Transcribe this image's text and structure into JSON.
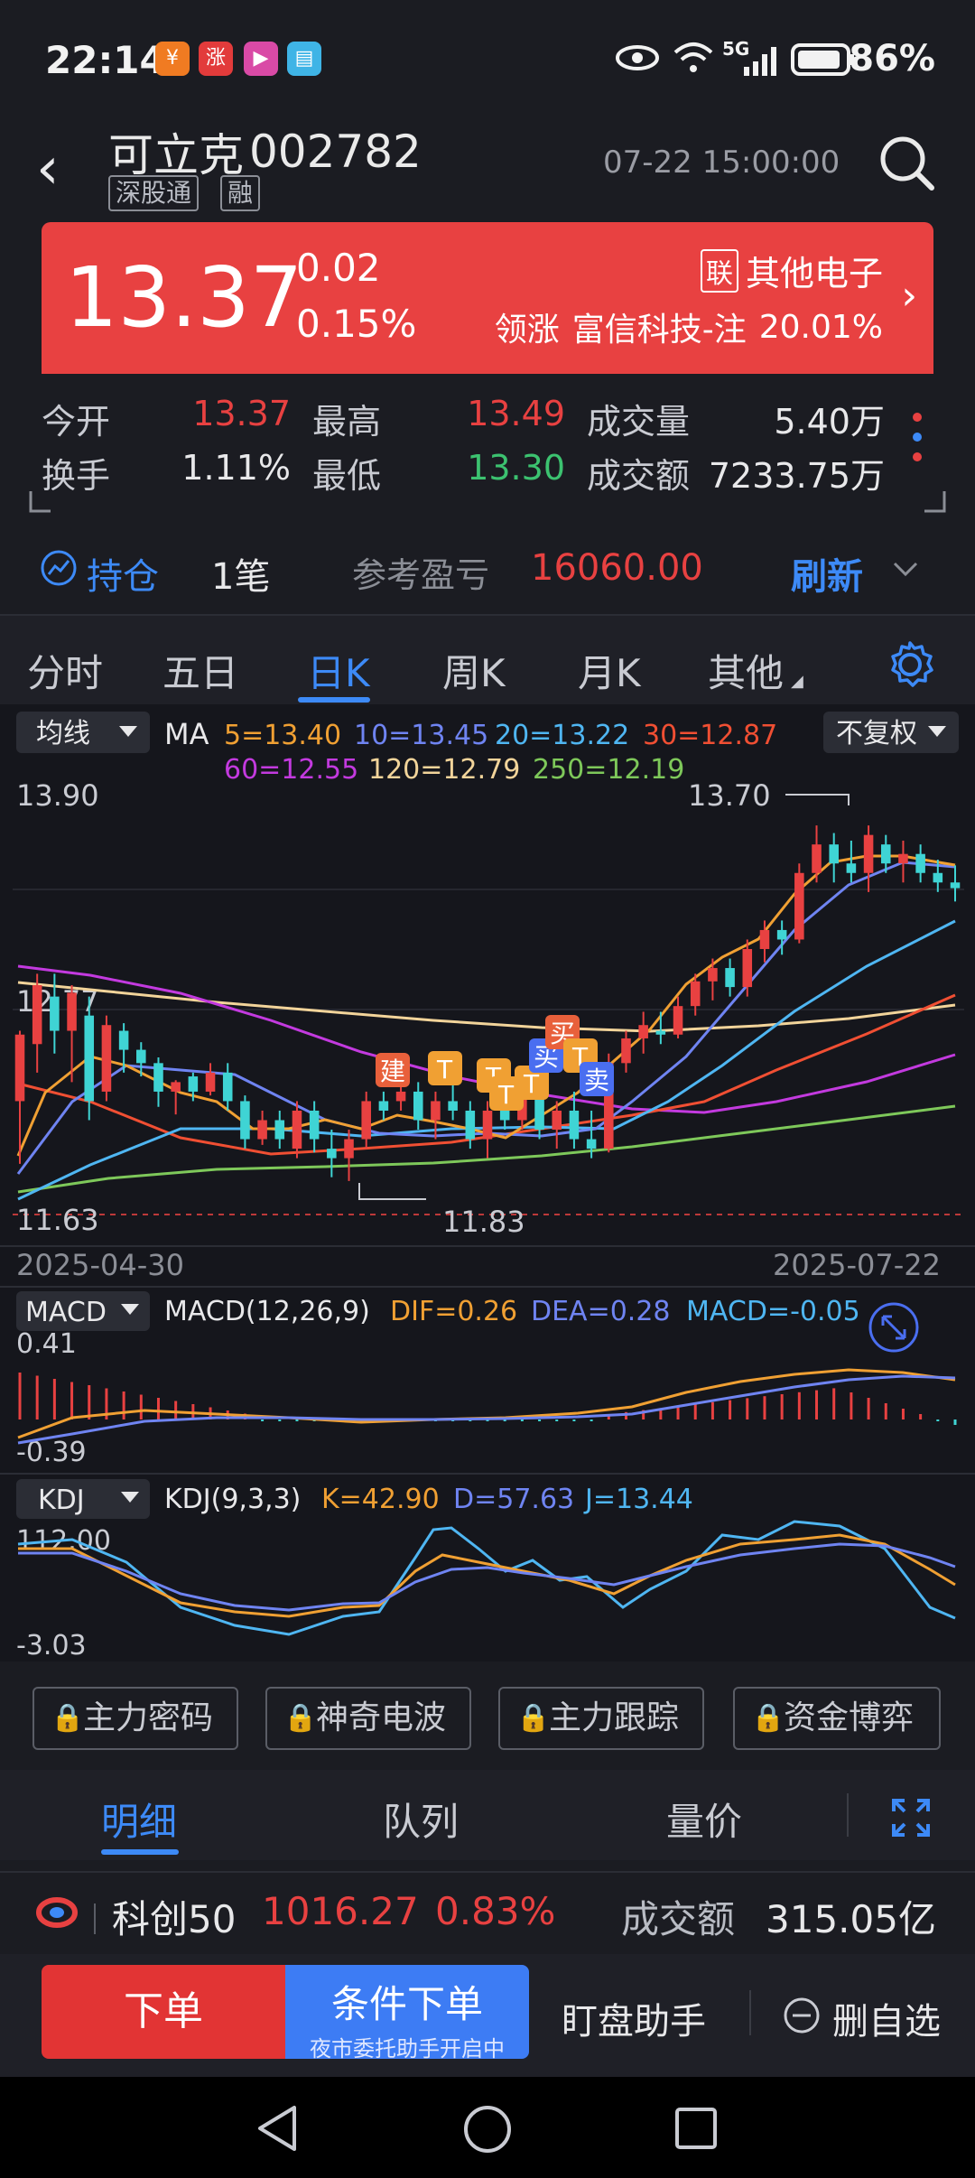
{
  "status": {
    "time": "22:14",
    "battery": "86%",
    "network": "5G",
    "notif_icons": [
      "red-envelope-icon",
      "zhang-app-icon",
      "video-app-icon",
      "book-app-icon"
    ],
    "notif_labels": [
      "¥",
      "涨",
      "▶",
      "📖"
    ]
  },
  "header": {
    "name": "可立克",
    "code": "002782",
    "tags": [
      "深股通",
      "融"
    ],
    "datetime": "07-22 15:00:00"
  },
  "price": {
    "last": "13.37",
    "change": "0.02",
    "change_pct": "0.15%",
    "sector_badge": "联",
    "sector": "其他电子",
    "lead_label": "领涨",
    "lead_stock": "富信科技-注",
    "lead_pct": "20.01%",
    "banner_color": "#e84141"
  },
  "quote": {
    "open_label": "今开",
    "open": "13.37",
    "high_label": "最高",
    "high": "13.49",
    "volume_label": "成交量",
    "volume": "5.40万",
    "turnover_label": "换手",
    "turnover": "1.11%",
    "low_label": "最低",
    "low": "13.30",
    "amount_label": "成交额",
    "amount": "7233.75万"
  },
  "position": {
    "label": "持仓",
    "count": "1笔",
    "pl_label": "参考盈亏",
    "pl_value": "16060.00",
    "refresh": "刷新"
  },
  "tabs": [
    "分时",
    "五日",
    "日K",
    "周K",
    "月K",
    "其他"
  ],
  "active_tab": "日K",
  "chart": {
    "ma_selector": "均线",
    "ma_label": "MA",
    "ma_values": [
      {
        "text": "5=13.40",
        "color": "#f0a033"
      },
      {
        "text": "10=13.45",
        "color": "#6f84f2"
      },
      {
        "text": "20=13.22",
        "color": "#4fb6f2"
      },
      {
        "text": "30=12.87",
        "color": "#f04f33"
      },
      {
        "text": "60=12.55",
        "color": "#c33adf"
      },
      {
        "text": "120=12.79",
        "color": "#f2d49a"
      },
      {
        "text": "250=12.19",
        "color": "#7ec85a"
      }
    ],
    "adjust": "不复权",
    "price_top": "13.90",
    "price_mid": "12.77",
    "price_bottom": "11.63",
    "high_mark": "13.70",
    "low_mark": "11.83",
    "date_start": "2025-04-30",
    "date_end": "2025-07-22",
    "trade_marks": [
      "建",
      "T",
      "T",
      "T",
      "T",
      "买",
      "卖",
      "T",
      "买",
      "卖"
    ],
    "macd_selector": "MACD",
    "macd_params": "MACD(12,26,9)",
    "macd_dif": "DIF=0.26",
    "macd_dea": "DEA=0.28",
    "macd_val": "MACD=-0.05",
    "macd_top": "0.41",
    "macd_bottom": "-0.39",
    "kdj_selector": "KDJ",
    "kdj_params": "KDJ(9,3,3)",
    "kdj_k": "K=42.90",
    "kdj_d": "D=57.63",
    "kdj_j": "J=13.44",
    "kdj_top": "112.00",
    "kdj_bottom": "-3.03"
  },
  "chart_data": {
    "type": "candlestick",
    "x_start": "2025-04-30",
    "x_end": "2025-07-22",
    "ylim": [
      11.63,
      13.9
    ],
    "up_color": "#e84141",
    "down_color": "#3fd4d4",
    "candles": [
      {
        "o": 12.25,
        "h": 12.62,
        "l": 11.92,
        "c": 12.6
      },
      {
        "o": 12.55,
        "h": 12.92,
        "l": 12.4,
        "c": 12.86
      },
      {
        "o": 12.8,
        "h": 12.92,
        "l": 12.5,
        "c": 12.62
      },
      {
        "o": 12.62,
        "h": 12.86,
        "l": 12.35,
        "c": 12.82
      },
      {
        "o": 12.7,
        "h": 12.8,
        "l": 12.15,
        "c": 12.25
      },
      {
        "o": 12.3,
        "h": 12.7,
        "l": 12.25,
        "c": 12.65
      },
      {
        "o": 12.62,
        "h": 12.66,
        "l": 12.4,
        "c": 12.52
      },
      {
        "o": 12.52,
        "h": 12.56,
        "l": 12.38,
        "c": 12.45
      },
      {
        "o": 12.45,
        "h": 12.48,
        "l": 12.22,
        "c": 12.3
      },
      {
        "o": 12.3,
        "h": 12.36,
        "l": 12.18,
        "c": 12.35
      },
      {
        "o": 12.38,
        "h": 12.4,
        "l": 12.25,
        "c": 12.3
      },
      {
        "o": 12.3,
        "h": 12.45,
        "l": 12.28,
        "c": 12.4
      },
      {
        "o": 12.4,
        "h": 12.45,
        "l": 12.2,
        "c": 12.25
      },
      {
        "o": 12.25,
        "h": 12.28,
        "l": 12.0,
        "c": 12.05
      },
      {
        "o": 12.05,
        "h": 12.2,
        "l": 12.02,
        "c": 12.15
      },
      {
        "o": 12.15,
        "h": 12.2,
        "l": 12.0,
        "c": 12.05
      },
      {
        "o": 12.0,
        "h": 12.25,
        "l": 11.95,
        "c": 12.2
      },
      {
        "o": 12.2,
        "h": 12.25,
        "l": 11.98,
        "c": 12.05
      },
      {
        "o": 12.0,
        "h": 12.1,
        "l": 11.85,
        "c": 11.95
      },
      {
        "o": 11.95,
        "h": 12.1,
        "l": 11.83,
        "c": 12.05
      },
      {
        "o": 12.05,
        "h": 12.3,
        "l": 12.0,
        "c": 12.25
      },
      {
        "o": 12.25,
        "h": 12.3,
        "l": 12.15,
        "c": 12.2
      },
      {
        "o": 12.25,
        "h": 12.35,
        "l": 12.2,
        "c": 12.3
      },
      {
        "o": 12.3,
        "h": 12.35,
        "l": 12.1,
        "c": 12.15
      },
      {
        "o": 12.15,
        "h": 12.3,
        "l": 12.05,
        "c": 12.25
      },
      {
        "o": 12.25,
        "h": 12.35,
        "l": 12.15,
        "c": 12.2
      },
      {
        "o": 12.2,
        "h": 12.25,
        "l": 12.0,
        "c": 12.05
      },
      {
        "o": 12.05,
        "h": 12.25,
        "l": 11.95,
        "c": 12.2
      },
      {
        "o": 12.2,
        "h": 12.3,
        "l": 12.1,
        "c": 12.15
      },
      {
        "o": 12.15,
        "h": 12.35,
        "l": 12.1,
        "c": 12.3
      },
      {
        "o": 12.3,
        "h": 12.4,
        "l": 12.05,
        "c": 12.1
      },
      {
        "o": 12.1,
        "h": 12.25,
        "l": 12.0,
        "c": 12.2
      },
      {
        "o": 12.2,
        "h": 12.3,
        "l": 12.0,
        "c": 12.05
      },
      {
        "o": 12.05,
        "h": 12.2,
        "l": 11.95,
        "c": 12.0
      },
      {
        "o": 12.0,
        "h": 12.5,
        "l": 11.98,
        "c": 12.45
      },
      {
        "o": 12.45,
        "h": 12.62,
        "l": 12.4,
        "c": 12.58
      },
      {
        "o": 12.58,
        "h": 12.72,
        "l": 12.5,
        "c": 12.65
      },
      {
        "o": 12.62,
        "h": 12.72,
        "l": 12.55,
        "c": 12.6
      },
      {
        "o": 12.6,
        "h": 12.8,
        "l": 12.58,
        "c": 12.75
      },
      {
        "o": 12.75,
        "h": 12.92,
        "l": 12.7,
        "c": 12.88
      },
      {
        "o": 12.88,
        "h": 13.0,
        "l": 12.78,
        "c": 12.95
      },
      {
        "o": 12.95,
        "h": 13.0,
        "l": 12.8,
        "c": 12.85
      },
      {
        "o": 12.85,
        "h": 13.1,
        "l": 12.8,
        "c": 13.05
      },
      {
        "o": 13.05,
        "h": 13.2,
        "l": 12.98,
        "c": 13.15
      },
      {
        "o": 13.15,
        "h": 13.2,
        "l": 13.02,
        "c": 13.1
      },
      {
        "o": 13.1,
        "h": 13.5,
        "l": 13.08,
        "c": 13.45
      },
      {
        "o": 13.45,
        "h": 13.7,
        "l": 13.4,
        "c": 13.6
      },
      {
        "o": 13.6,
        "h": 13.66,
        "l": 13.4,
        "c": 13.5
      },
      {
        "o": 13.5,
        "h": 13.62,
        "l": 13.4,
        "c": 13.45
      },
      {
        "o": 13.45,
        "h": 13.7,
        "l": 13.35,
        "c": 13.65
      },
      {
        "o": 13.6,
        "h": 13.65,
        "l": 13.45,
        "c": 13.5
      },
      {
        "o": 13.5,
        "h": 13.62,
        "l": 13.4,
        "c": 13.55
      },
      {
        "o": 13.55,
        "h": 13.6,
        "l": 13.4,
        "c": 13.45
      },
      {
        "o": 13.45,
        "h": 13.52,
        "l": 13.35,
        "c": 13.4
      },
      {
        "o": 13.4,
        "h": 13.49,
        "l": 13.3,
        "c": 13.37
      }
    ]
  },
  "indicator_buttons": [
    "主力密码",
    "神奇电波",
    "主力跟踪",
    "资金博弈"
  ],
  "detail_tabs": [
    "明细",
    "队列",
    "量价"
  ],
  "active_detail_tab": "明细",
  "index": {
    "name": "科创50",
    "value": "1016.27",
    "pct": "0.83%",
    "amount_label": "成交额",
    "amount": "315.05亿"
  },
  "actions": {
    "order": "下单",
    "conditional": "条件下单",
    "conditional_sub": "夜市委托助手开启中",
    "monitor": "盯盘助手",
    "remove": "删自选"
  }
}
